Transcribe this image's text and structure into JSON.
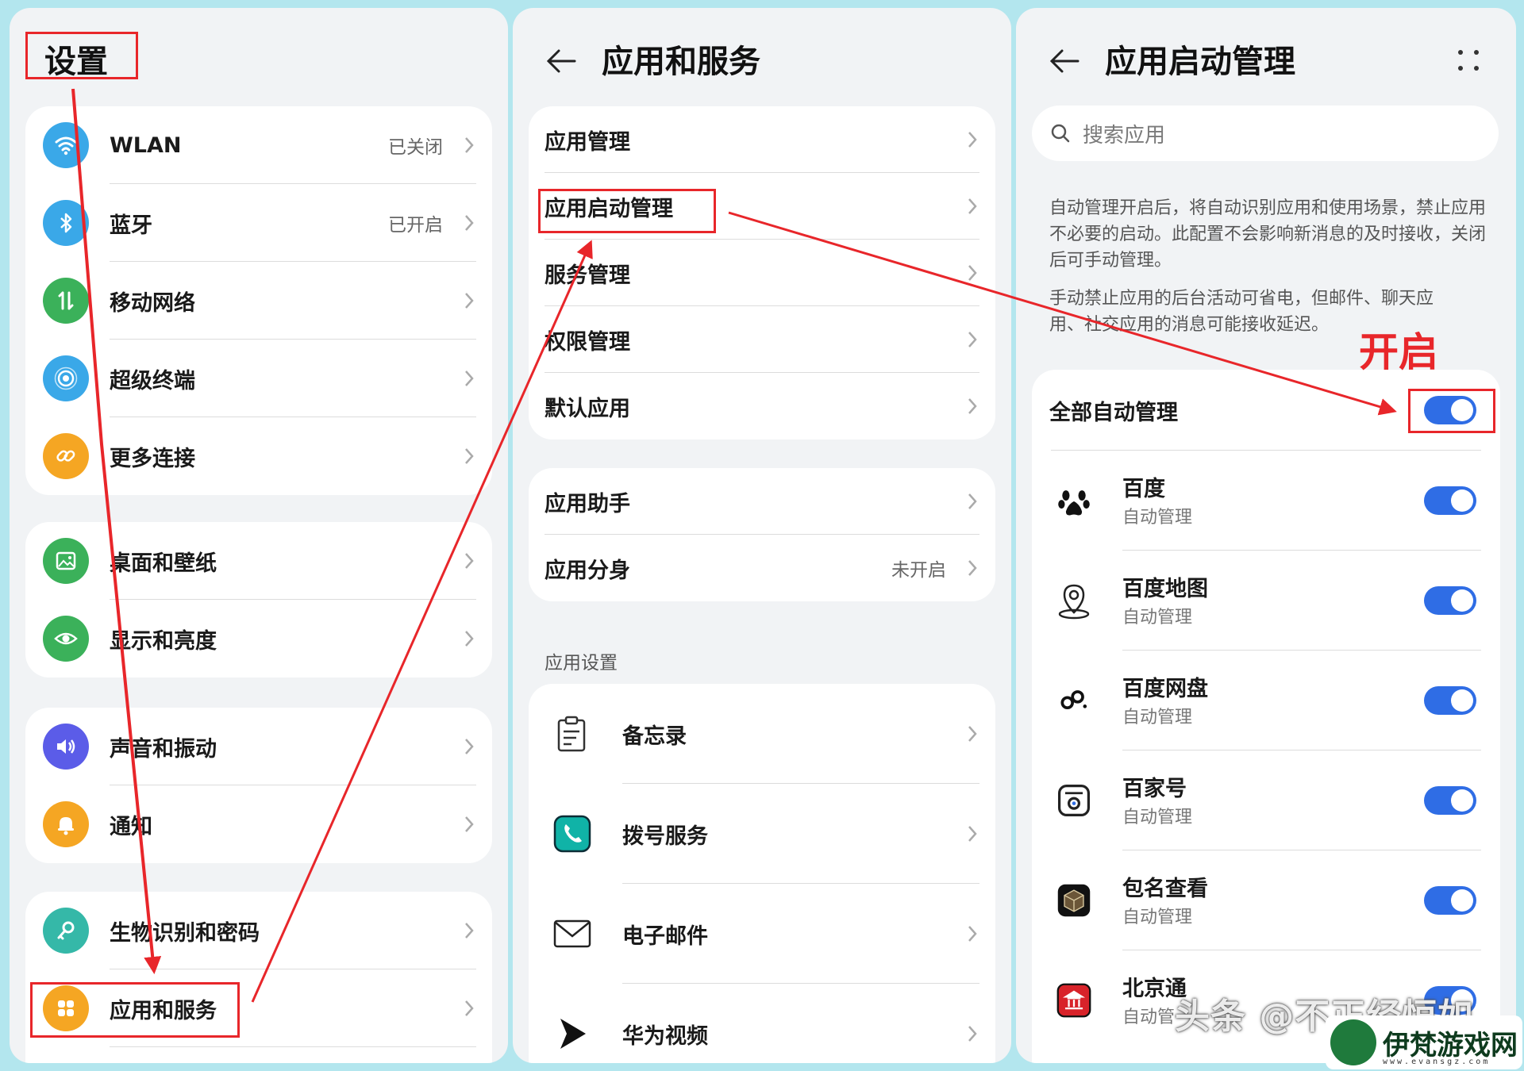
{
  "panel1": {
    "title": "设置",
    "group1": [
      {
        "label": "WLAN",
        "value": "已关闭",
        "icon": "wifi-icon",
        "color": "#3aa8e8"
      },
      {
        "label": "蓝牙",
        "value": "已开启",
        "icon": "bluetooth-icon",
        "color": "#3aa8e8"
      },
      {
        "label": "移动网络",
        "value": "",
        "icon": "mobile-network-icon",
        "color": "#3bb15a"
      },
      {
        "label": "超级终端",
        "value": "",
        "icon": "super-device-icon",
        "color": "#3aa8e8"
      },
      {
        "label": "更多连接",
        "value": "",
        "icon": "link-icon",
        "color": "#f5a623"
      }
    ],
    "group2": [
      {
        "label": "桌面和壁纸",
        "icon": "wallpaper-icon",
        "color": "#3bb15a"
      },
      {
        "label": "显示和亮度",
        "icon": "eye-icon",
        "color": "#3bb15a"
      }
    ],
    "group3": [
      {
        "label": "声音和振动",
        "icon": "sound-icon",
        "color": "#5b5ce8"
      },
      {
        "label": "通知",
        "icon": "bell-icon",
        "color": "#f5a623"
      }
    ],
    "group4": [
      {
        "label": "生物识别和密码",
        "icon": "key-icon",
        "color": "#35b8a8"
      },
      {
        "label": "应用和服务",
        "icon": "apps-icon",
        "color": "#f5a623"
      }
    ]
  },
  "panel2": {
    "title": "应用和服务",
    "group1": [
      {
        "label": "应用管理"
      },
      {
        "label": "应用启动管理"
      },
      {
        "label": "服务管理"
      },
      {
        "label": "权限管理"
      },
      {
        "label": "默认应用"
      }
    ],
    "group2": [
      {
        "label": "应用助手",
        "value": ""
      },
      {
        "label": "应用分身",
        "value": "未开启"
      }
    ],
    "section": "应用设置",
    "group3": [
      {
        "label": "备忘录",
        "icon": "memo-icon"
      },
      {
        "label": "拨号服务",
        "icon": "phone-icon"
      },
      {
        "label": "电子邮件",
        "icon": "mail-icon"
      },
      {
        "label": "华为视频",
        "icon": "video-icon"
      }
    ]
  },
  "panel3": {
    "title": "应用启动管理",
    "search_placeholder": "搜索应用",
    "desc1": "自动管理开启后，将自动识别应用和使用场景，禁止应用不必要的启动。此配置不会影响新消息的及时接收，关闭后可手动管理。",
    "desc2": "手动禁止应用的后台活动可省电，但邮件、聊天应用、社交应用的消息可能接收延迟。",
    "all_label": "全部自动管理",
    "accent": "#2f6de5",
    "apps": [
      {
        "name": "百度",
        "sub": "自动管理",
        "icon": "paw-icon"
      },
      {
        "name": "百度地图",
        "sub": "自动管理",
        "icon": "map-pin-icon"
      },
      {
        "name": "百度网盘",
        "sub": "自动管理",
        "icon": "cloud-disk-icon"
      },
      {
        "name": "百家号",
        "sub": "自动管理",
        "icon": "baijiahao-icon"
      },
      {
        "name": "包名查看",
        "sub": "自动管理",
        "icon": "package-icon"
      },
      {
        "name": "北京通",
        "sub": "自动管",
        "icon": "beijing-icon"
      }
    ]
  },
  "annotation": {
    "open_label": "开启",
    "highlight_color": "#e8262a"
  },
  "watermark": {
    "text": "头条 @不正经恒如",
    "site_name": "伊梵游戏网",
    "site_url": "www.evansgz.com"
  }
}
